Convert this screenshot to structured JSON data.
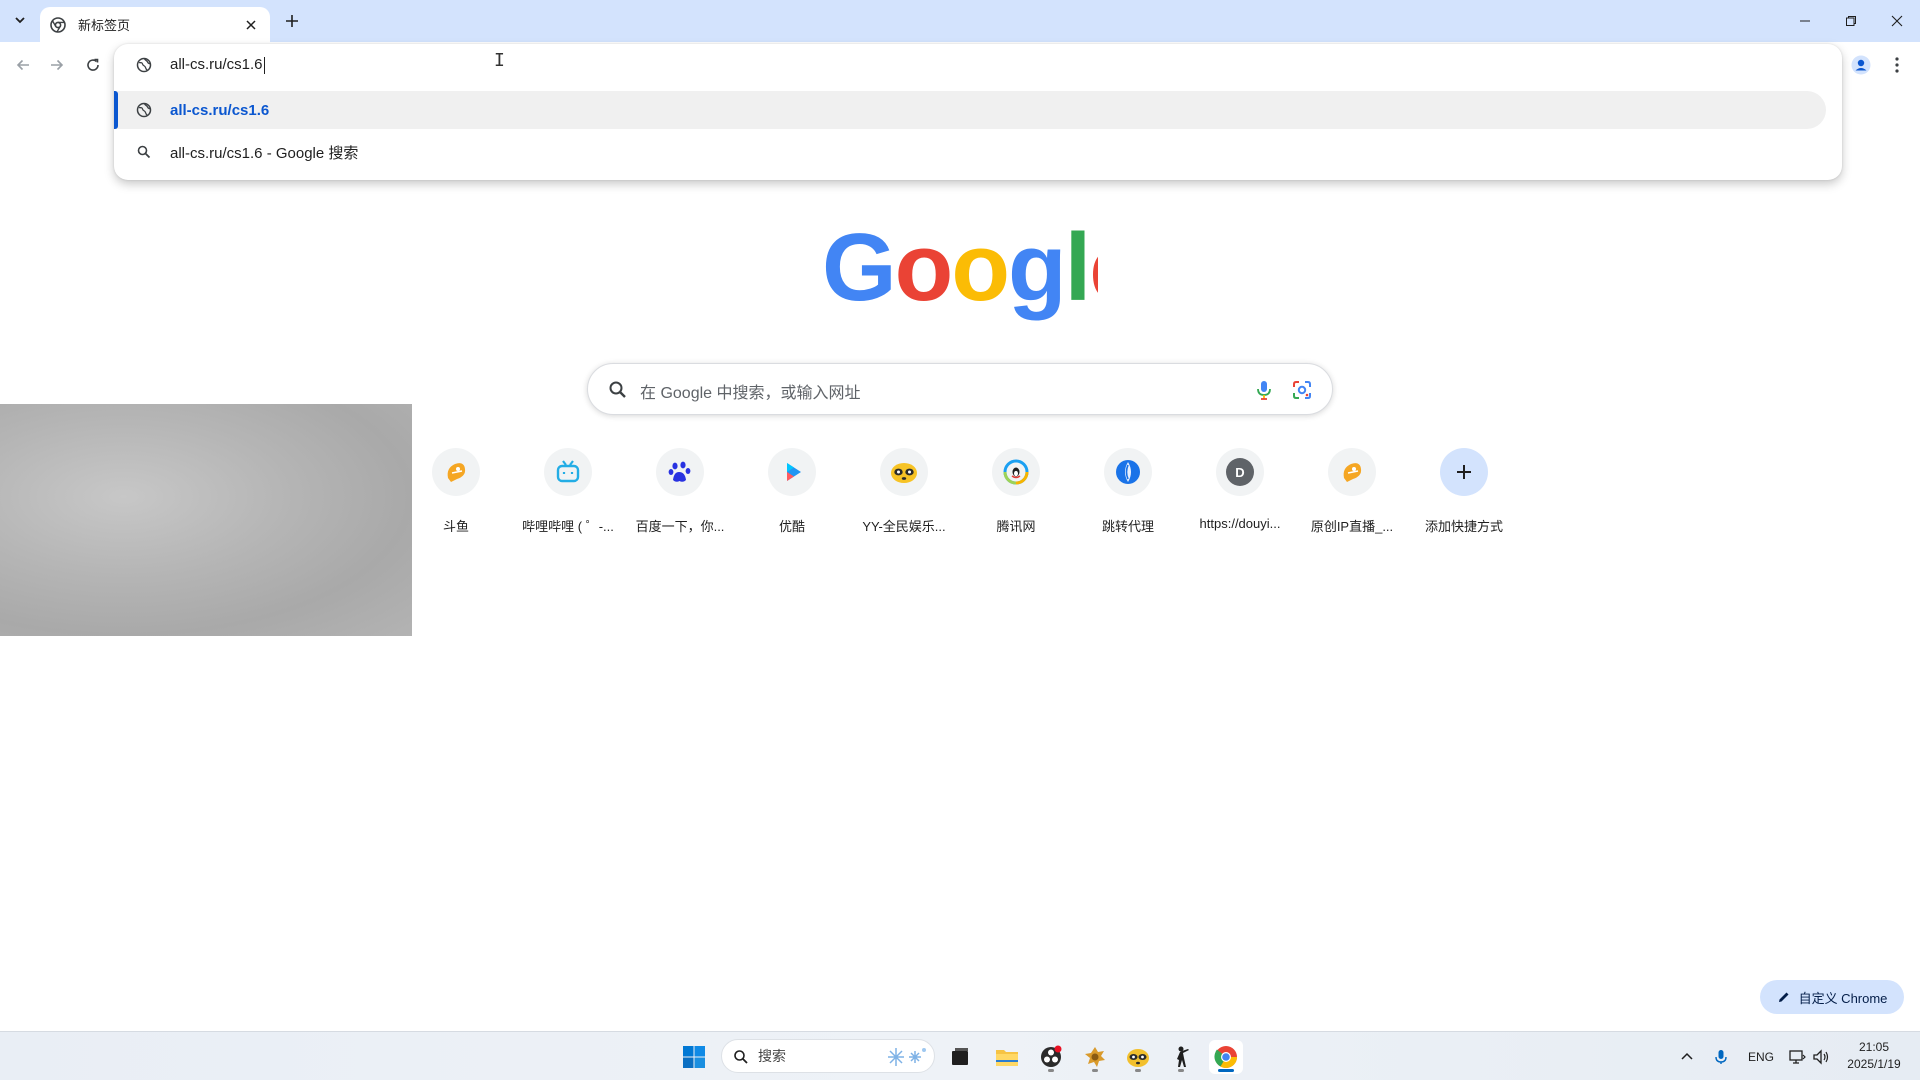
{
  "browser": {
    "tab": {
      "title": "新标签页"
    },
    "window_controls": [
      "minimize",
      "restore",
      "close"
    ]
  },
  "omnibox": {
    "input_value": "all-cs.ru/cs1.6",
    "suggestions": [
      {
        "text": "all-cs.ru/cs1.6",
        "icon": "globe-icon",
        "selected": true
      },
      {
        "text": "all-cs.ru/cs1.6 - Google 搜索",
        "icon": "search-icon",
        "selected": false
      }
    ]
  },
  "ntp": {
    "logo": "Google",
    "search_placeholder": "在 Google 中搜索，或输入网址",
    "shortcuts": [
      {
        "label": "斗鱼",
        "icon": "douyu-icon",
        "color": "#f5a623"
      },
      {
        "label": "哔哩哔哩 ( ゜-...",
        "icon": "bilibili-icon",
        "color": "#23ade5"
      },
      {
        "label": "百度一下，你...",
        "icon": "baidu-paw-icon",
        "color": "#2932e1"
      },
      {
        "label": "优酷",
        "icon": "youku-icon",
        "color": "#2196f3"
      },
      {
        "label": "YY-全民娱乐...",
        "icon": "yy-icon",
        "color": "#f7c325"
      },
      {
        "label": "腾讯网",
        "icon": "tencent-icon",
        "color": "#1ba0f2"
      },
      {
        "label": "跳转代理",
        "icon": "proxy-icon",
        "color": "#1a73e8"
      },
      {
        "label": "https://douyi...",
        "icon": "letter-d-icon",
        "color": "#5f6368",
        "letter": "D"
      },
      {
        "label": "原创IP直播_...",
        "icon": "douyu-icon",
        "color": "#f5a623"
      },
      {
        "label": "添加快捷方式",
        "icon": "plus-icon",
        "color": "#1f1f1f"
      }
    ],
    "customize_label": "自定义 Chrome"
  },
  "taskbar": {
    "search_label": "搜索",
    "tray_lang": "ENG",
    "time": "21:05",
    "date": "2025/1/19"
  },
  "colors": {
    "tabstrip": "#d3e3fd",
    "accent": "#0b57d0",
    "google_blue": "#4285f4",
    "google_red": "#ea4335",
    "google_yellow": "#fbbc05",
    "google_green": "#34a853"
  }
}
